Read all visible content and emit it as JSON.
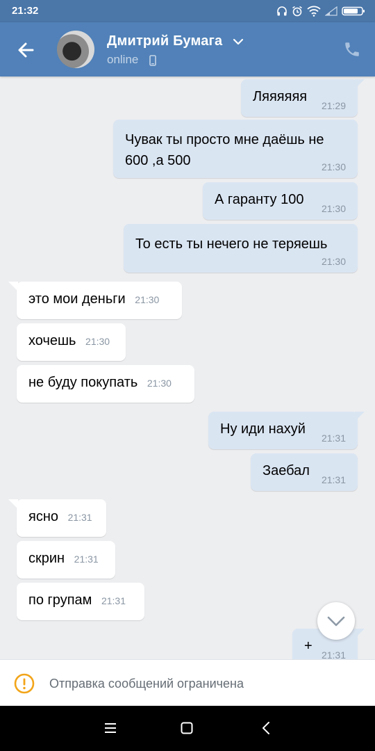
{
  "status_bar": {
    "time": "21:32"
  },
  "header": {
    "contact_name": "Дмитрий Бумага",
    "status": "online",
    "back_label": "back",
    "icons": [
      "back-arrow-icon",
      "chevron-down-icon",
      "mobile-phone-icon",
      "phone-call-icon"
    ]
  },
  "messages": [
    {
      "dir": "out",
      "text": "Ляяяяяя",
      "time": "21:29"
    },
    {
      "dir": "out",
      "text": "Чувак ты просто мне даёшь не 600 ,а 500",
      "time": "21:30"
    },
    {
      "dir": "out",
      "text": "А гаранту 100",
      "time": "21:30"
    },
    {
      "dir": "out",
      "text": "То есть ты нечего не теряешь",
      "time": "21:30"
    },
    {
      "dir": "in",
      "text": "это мои деньги",
      "time": "21:30"
    },
    {
      "dir": "in",
      "text": "хочешь",
      "time": "21:30"
    },
    {
      "dir": "in",
      "text": "не буду покупать",
      "time": "21:30"
    },
    {
      "dir": "out",
      "text": "Ну иди нахуй",
      "time": "21:31"
    },
    {
      "dir": "out",
      "text": "Заебал",
      "time": "21:31"
    },
    {
      "dir": "in",
      "text": "ясно",
      "time": "21:31"
    },
    {
      "dir": "in",
      "text": "скрин",
      "time": "21:31"
    },
    {
      "dir": "in",
      "text": "по групам",
      "time": "21:31"
    },
    {
      "dir": "out",
      "text": "+",
      "time": "21:31"
    }
  ],
  "restriction": {
    "text": "Отправка сообщений ограничена",
    "icon": "warning-icon"
  },
  "colors": {
    "header": "#5181b8",
    "status_bar": "#4a76a8",
    "outgoing_bubble": "#dae5f2",
    "incoming_bubble": "#ffffff",
    "chat_bg": "#edeef0",
    "warning": "#f2a51a"
  }
}
